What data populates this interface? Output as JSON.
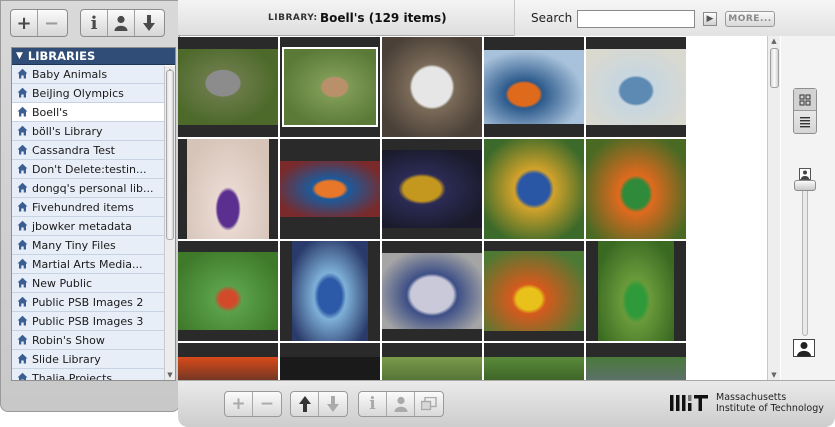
{
  "left_toolbar": {
    "add_label": "+",
    "remove_label": "−",
    "info_label": "i",
    "user_icon": "person-icon",
    "download_icon": "down-arrow-icon"
  },
  "libraries": {
    "header": "LIBRARIES",
    "items": [
      {
        "label": "Baby Animals"
      },
      {
        "label": "BeiJing Olympics"
      },
      {
        "label": "Boell's"
      },
      {
        "label": "böll's Library"
      },
      {
        "label": "Cassandra Test"
      },
      {
        "label": "Don't Delete:testin..."
      },
      {
        "label": "dongq's personal lib..."
      },
      {
        "label": "Fivehundred items"
      },
      {
        "label": "jbowker metadata"
      },
      {
        "label": "Many Tiny Files"
      },
      {
        "label": "Martial Arts Media..."
      },
      {
        "label": "New Public"
      },
      {
        "label": "Public PSB Images 2"
      },
      {
        "label": "Public PSB Images 3"
      },
      {
        "label": "Robin's Show"
      },
      {
        "label": "Slide Library"
      },
      {
        "label": "Thalia Projects"
      }
    ],
    "selected_index": 2
  },
  "header": {
    "library_label": "LIBRARY:",
    "library_name": "Boell's (129 items)"
  },
  "search": {
    "label": "Search",
    "value": "",
    "placeholder": "",
    "go_icon": "arrow-right-icon",
    "more_label": "MORE..."
  },
  "thumbnails": [
    {
      "subject": "grey rabbit on grass"
    },
    {
      "subject": "brown rabbit on grass"
    },
    {
      "subject": "white rabbit in cage"
    },
    {
      "subject": "glass pumpkins orange"
    },
    {
      "subject": "glass pumpkins striped"
    },
    {
      "subject": "glass pumpkins white and purple"
    },
    {
      "subject": "glass pumpkins orange and blue"
    },
    {
      "subject": "glass pumpkins gold"
    },
    {
      "subject": "glass pumpkins blue"
    },
    {
      "subject": "glass pumpkins green"
    },
    {
      "subject": "glass pumpkins on lawn"
    },
    {
      "subject": "blue glass pumpkin"
    },
    {
      "subject": "large glass pumpkin"
    },
    {
      "subject": "glass pumpkins yellow and orange"
    },
    {
      "subject": "green glass pumpkin in leaves"
    }
  ],
  "view": {
    "grid_icon": "grid-view-icon",
    "list_icon": "list-view-icon",
    "zoom_level": 0.08
  },
  "bottom_toolbar": {
    "add_label": "+",
    "remove_label": "−",
    "up_icon": "up-arrow-icon",
    "down_icon": "down-arrow-icon",
    "info_label": "i",
    "person_icon": "person-icon",
    "slideshow_icon": "slideshow-icon"
  },
  "branding": {
    "logo": "MIT",
    "line1": "Massachusetts",
    "line2": "Institute of Technology"
  },
  "colors": {
    "library_header": "#2f4d77",
    "list_row": "#e8eef8"
  }
}
